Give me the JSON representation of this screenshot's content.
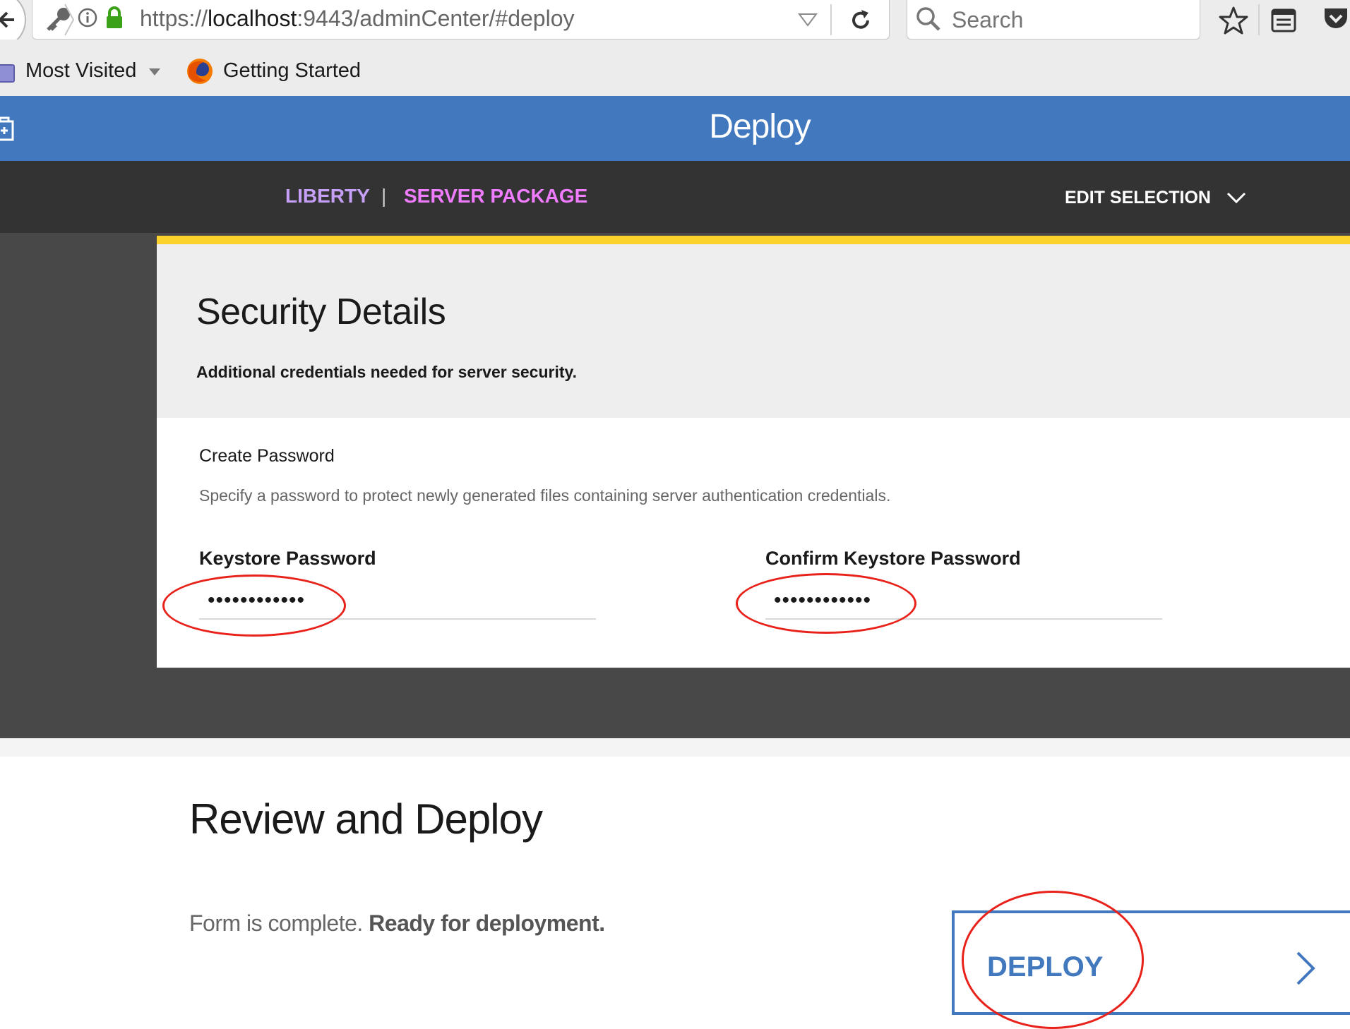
{
  "browser": {
    "url_prefix": "https://",
    "url_host": "localhost",
    "url_rest": ":9443/adminCenter/#deploy",
    "search_placeholder": "Search",
    "bookmarks": [
      {
        "label": "Most Visited"
      },
      {
        "label": "Getting Started"
      }
    ]
  },
  "header": {
    "title": "Deploy"
  },
  "nav": {
    "liberty_label": "LIBERTY",
    "separator": "|",
    "server_package_label": "SERVER PACKAGE",
    "edit_selection_label": "EDIT SELECTION"
  },
  "security": {
    "title": "Security Details",
    "subtitle": "Additional credentials needed for server security.",
    "password_heading": "Create Password",
    "password_description": "Specify a password to protect newly generated files containing server authentication credentials.",
    "keystore_label": "Keystore Password",
    "keystore_value": "••••••••••••",
    "confirm_label": "Confirm Keystore Password",
    "confirm_value": "••••••••••••"
  },
  "review": {
    "title": "Review and Deploy",
    "status_plain": "Form is complete. ",
    "status_bold": "Ready for deployment.",
    "deploy_label": "DEPLOY"
  },
  "colors": {
    "brand_blue": "#4178be",
    "accent_yellow": "#fbd22b",
    "nav_purple": "#c6a0f6",
    "nav_pink": "#f07cff",
    "annotation_red": "#e8221b"
  }
}
